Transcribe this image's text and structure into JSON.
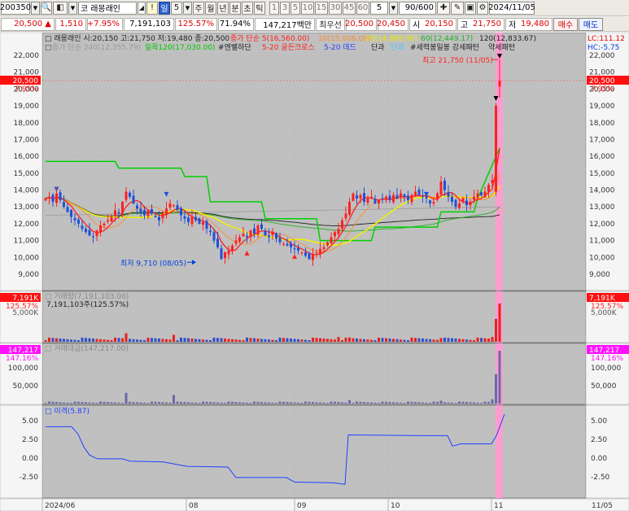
{
  "toolbar": {
    "code": "200350",
    "market_badge": "코",
    "stock_name": "래몽래인",
    "period_buttons": [
      {
        "label": "!",
        "active": false
      },
      {
        "label": "일",
        "active": true
      },
      {
        "label": "5",
        "active": false
      },
      {
        "label": "주",
        "active": false
      },
      {
        "label": "월",
        "active": false
      },
      {
        "label": "년",
        "active": false
      },
      {
        "label": "분",
        "active": false
      },
      {
        "label": "초",
        "active": false
      },
      {
        "label": "틱",
        "active": false
      }
    ],
    "minute_buttons": [
      "1",
      "3",
      "5",
      "10",
      "15",
      "30",
      "45",
      "60"
    ],
    "minute_value": "5",
    "count_value": "90",
    "count_total": "/600",
    "date": "2024/11/05"
  },
  "quote": {
    "price": "20,500",
    "arrow": "▲",
    "change": "1,510",
    "change_pct": "+7.95%",
    "volume": "7,191,103",
    "volume_pct": "125.57%",
    "turnover_ratio": "71.94%",
    "amount": "147,217백만",
    "priority_label": "최우선",
    "ask": "20,500",
    "bid": "20,450",
    "open_label": "시",
    "open": "20,150",
    "high_label": "고",
    "high": "21,750",
    "low_label": "저",
    "low": "19,480",
    "buy_label": "매수",
    "sell_label": "매도"
  },
  "price_panel": {
    "title": "래몽래인 시:20,150 고:21,750 저:19,480 종:20,500",
    "legend_row1": [
      {
        "text": "종가 단순 5(16,560.00)",
        "color": "#ff2020"
      },
      {
        "text": "10(15,006.00)",
        "color": "#ff8c28"
      },
      {
        "text": "20(14,888.00)",
        "color": "#e8e800"
      },
      {
        "text": "60(12,449.17)",
        "color": "#20b020"
      },
      {
        "text": "120(12,833.67)",
        "color": "#202020"
      }
    ],
    "legend_row2": [
      {
        "text": "종가 단순 240(12,355.79)",
        "color": "#9a9a9a"
      },
      {
        "text": "일목120(17,030.00)",
        "color": "#00c800"
      },
      {
        "text": "#엔벨하단",
        "color": "#202020"
      },
      {
        "text": "5-20 골든크로스",
        "color": "#ff2020"
      },
      {
        "text": "5-20 데드",
        "color": "#2040ff"
      },
      {
        "text": "단과",
        "color": "#202020"
      },
      {
        "text": "단과",
        "color": "#40c8ff"
      },
      {
        "text": "#세력봉일봉 강세패턴",
        "color": "#202020"
      },
      {
        "text": "약세패턴",
        "color": "#202020"
      }
    ],
    "lc": "LC:111.12",
    "hc": "HC:-5.75",
    "y_ticks": [
      "22,000",
      "21,000",
      "20,000",
      "19,000",
      "18,000",
      "17,000",
      "16,000",
      "15,000",
      "14,000",
      "13,000",
      "12,000",
      "11,000",
      "10,000",
      "9,000"
    ],
    "current_tag": "20,500",
    "current_pct": "7.95%",
    "high_annotation": "최고 21,750 (11/05)",
    "low_annotation": "최저 9,710 (08/05)"
  },
  "volume_panel": {
    "title": "거래량(7,191,103.00)",
    "sub": "7,191,103주(125.57%)",
    "tag": "7,191K",
    "tag_pct": "125.57%",
    "tick": "5,000K"
  },
  "amount_panel": {
    "title": "거래대금(147,217.00)",
    "tag": "147,217",
    "tag_pct": "147.16%",
    "ticks": [
      "100,000",
      "50,000"
    ]
  },
  "disparity_panel": {
    "title": "이격(5.87)",
    "ticks": [
      "5.00",
      "2.50",
      "0.00",
      "-2.50"
    ]
  },
  "x_axis": {
    "labels": [
      "2024/06",
      "08",
      "09",
      "10",
      "11"
    ],
    "right_label": "11/05"
  },
  "colors": {
    "up": "#ff2020",
    "down": "#2050d8",
    "panel_bg": "#c0c0c0",
    "highlight": "#ff9ad0",
    "volume_up": "#e82020",
    "volume_down": "#3050c8",
    "amount_bar": "#6a6aa8",
    "disparity": "#2040ff"
  }
}
